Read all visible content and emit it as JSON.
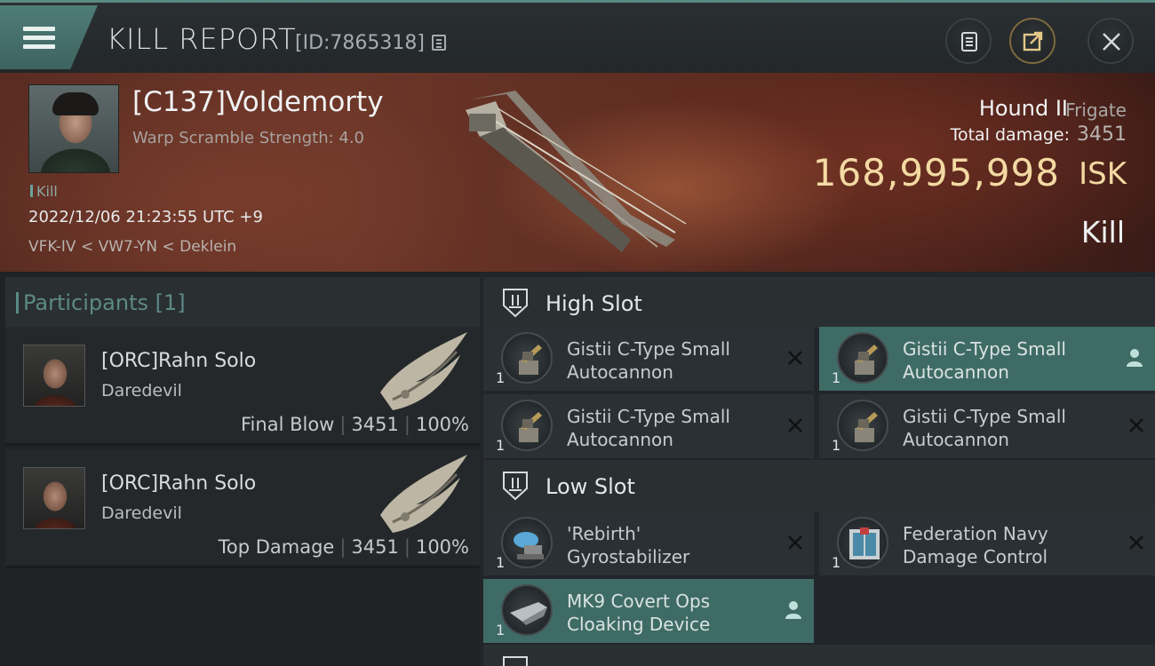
{
  "header": {
    "title": "KILL REPORT",
    "report_id": "[ID:7865318]"
  },
  "victim": {
    "name": "[C137]Voldemorty",
    "subtitle": "Warp Scramble Strength: 4.0",
    "event_tag": "Kill",
    "datetime": "2022/12/06 21:23:55 UTC +9",
    "location": "VFK-IV < VW7-YN < Deklein"
  },
  "ship": {
    "name": "Hound II",
    "class": "Frigate",
    "damage_label": "Total damage:",
    "damage_value": "3451",
    "isk_value": "168,995,998",
    "isk_unit": "ISK",
    "result": "Kill"
  },
  "participants": {
    "title": "Participants [1]",
    "rows": [
      {
        "name": "[ORC]Rahn Solo",
        "ship": "Daredevil",
        "label": "Final Blow",
        "damage": "3451",
        "percent": "100%"
      },
      {
        "name": "[ORC]Rahn Solo",
        "ship": "Daredevil",
        "label": "Top Damage",
        "damage": "3451",
        "percent": "100%"
      }
    ]
  },
  "fitting": {
    "high_slot_title": "High Slot",
    "low_slot_title": "Low Slot",
    "high_modules": [
      {
        "name": "Gistii C-Type Small\nAutocannon",
        "qty": "1",
        "icon": "autocannon-icon",
        "highlighted": false
      },
      {
        "name": "Gistii C-Type Small\nAutocannon",
        "qty": "1",
        "icon": "autocannon-icon",
        "highlighted": true
      },
      {
        "name": "Gistii C-Type Small\nAutocannon",
        "qty": "1",
        "icon": "autocannon-icon",
        "highlighted": false
      },
      {
        "name": "Gistii C-Type Small\nAutocannon",
        "qty": "1",
        "icon": "autocannon-icon",
        "highlighted": false
      }
    ],
    "low_modules": [
      {
        "name": "'Rebirth'\nGyrostabilizer",
        "qty": "1",
        "icon": "gyrostabilizer-icon",
        "highlighted": false
      },
      {
        "name": "Federation Navy\nDamage Control",
        "qty": "1",
        "icon": "damage-control-icon",
        "highlighted": false
      },
      {
        "name": "MK9 Covert Ops\nCloaking Device",
        "qty": "1",
        "icon": "cloaking-device-icon",
        "highlighted": true
      }
    ]
  },
  "colors": {
    "accent": "#5c8a84",
    "isk": "#f3d9a2",
    "highlight_row": "#3f6b66"
  }
}
